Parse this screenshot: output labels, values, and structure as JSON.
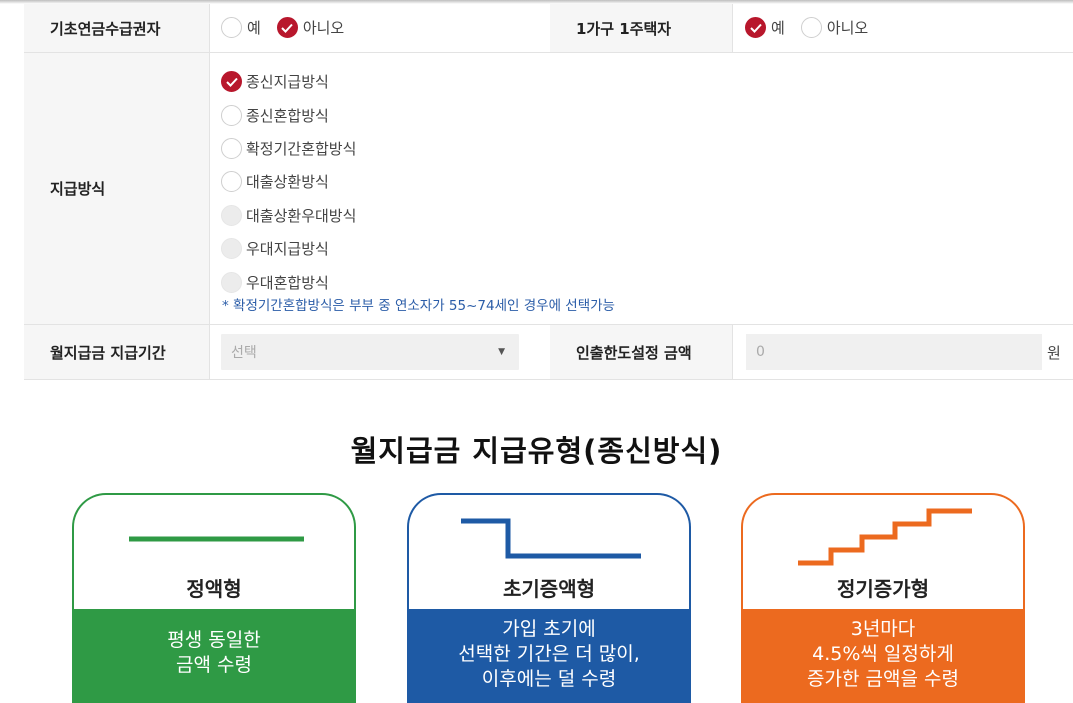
{
  "form": {
    "basic_pension": {
      "label": "기초연금수급권자",
      "options": [
        "예",
        "아니오"
      ],
      "selected": "아니오"
    },
    "one_house": {
      "label": "1가구 1주택자",
      "options": [
        "예",
        "아니오"
      ],
      "selected": "예"
    },
    "payment_method": {
      "label": "지급방식",
      "options": [
        "종신지급방식",
        "종신혼합방식",
        "확정기간혼합방식",
        "대출상환방식",
        "대출상환우대방식",
        "우대지급방식",
        "우대혼합방식"
      ],
      "selected": "종신지급방식",
      "disabled": [
        "대출상환우대방식",
        "우대지급방식",
        "우대혼합방식"
      ],
      "note": "* 확정기간혼합방식은 부부 중 연소자가 55~74세인 경우에 선택가능"
    },
    "monthly_period": {
      "label": "월지급금 지급기간",
      "value": "선택"
    },
    "withdraw_limit": {
      "label": "인출한도설정 금액",
      "value": "0",
      "unit": "원"
    }
  },
  "section": {
    "title": "월지급금  지급유형(종신방식)"
  },
  "cards": [
    {
      "name": "정액형",
      "desc": [
        "평생 동일한",
        "금액 수령"
      ],
      "color": "#2f9a45",
      "icon": "flat-line-icon"
    },
    {
      "name": "초기증액형",
      "desc": [
        "가입 초기에",
        "선택한 기간은 더 많이,",
        "이후에는 덜 수령"
      ],
      "color": "#1e5aa5",
      "icon": "step-down-icon"
    },
    {
      "name": "정기증가형",
      "desc": [
        "3년마다",
        "4.5%씩 일정하게",
        "증가한 금액을 수령"
      ],
      "color": "#ec6a1f",
      "icon": "stairs-up-icon"
    }
  ]
}
